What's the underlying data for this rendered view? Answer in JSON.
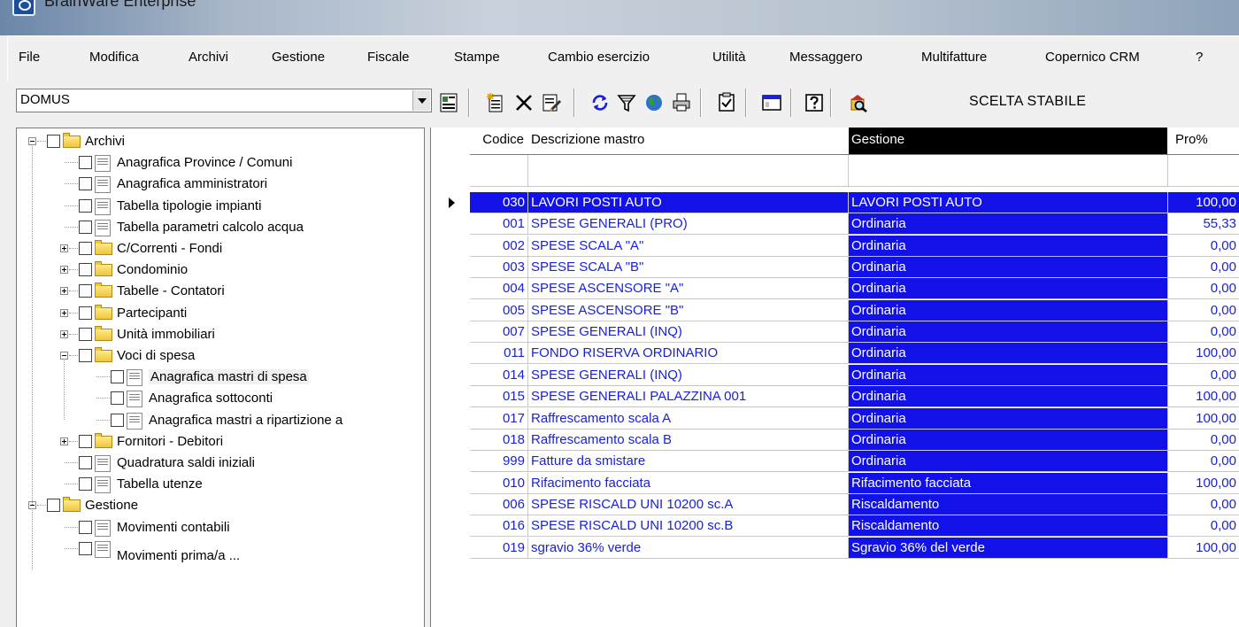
{
  "window": {
    "title": "BrainWare Enterprise"
  },
  "menu": [
    "File",
    "Modifica",
    "Archivi",
    "Gestione",
    "Fiscale",
    "Stampe",
    "Cambio esercizio",
    "Utilità",
    "Messaggero",
    "Multifatture",
    "Copernico CRM",
    "?"
  ],
  "toolbar": {
    "stabile_value": "DOMUS",
    "scelta_stabile": "SCELTA STABILE",
    "icons": [
      "stabile-icon",
      "new-icon",
      "delete-icon",
      "edit-icon",
      "refresh-icon",
      "filter-icon",
      "globe-icon",
      "print-icon",
      "check-icon",
      "window-icon",
      "help-icon",
      "search-building-icon"
    ]
  },
  "tree": [
    {
      "label": "Archivi",
      "level": 0,
      "expander": "minus",
      "icon": "folder"
    },
    {
      "label": "Anagrafica Province / Comuni",
      "level": 1,
      "expander": "",
      "icon": "doc"
    },
    {
      "label": "Anagrafica amministratori",
      "level": 1,
      "expander": "",
      "icon": "doc"
    },
    {
      "label": "Tabella tipologie impianti",
      "level": 1,
      "expander": "",
      "icon": "doc"
    },
    {
      "label": "Tabella parametri calcolo acqua",
      "level": 1,
      "expander": "",
      "icon": "doc"
    },
    {
      "label": "C/Correnti - Fondi",
      "level": 1,
      "expander": "plus",
      "icon": "folder"
    },
    {
      "label": "Condominio",
      "level": 1,
      "expander": "plus",
      "icon": "folder"
    },
    {
      "label": "Tabelle - Contatori",
      "level": 1,
      "expander": "plus",
      "icon": "folder"
    },
    {
      "label": "Partecipanti",
      "level": 1,
      "expander": "plus",
      "icon": "folder"
    },
    {
      "label": "Unità immobiliari",
      "level": 1,
      "expander": "plus",
      "icon": "folder"
    },
    {
      "label": "Voci di spesa",
      "level": 1,
      "expander": "minus",
      "icon": "folder"
    },
    {
      "label": "Anagrafica mastri di spesa",
      "level": 2,
      "expander": "",
      "icon": "doc",
      "selected": true
    },
    {
      "label": "Anagrafica sottoconti",
      "level": 2,
      "expander": "",
      "icon": "doc"
    },
    {
      "label": "Anagrafica mastri a ripartizione a",
      "level": 2,
      "expander": "",
      "icon": "doc"
    },
    {
      "label": "Fornitori - Debitori",
      "level": 1,
      "expander": "plus",
      "icon": "folder"
    },
    {
      "label": "Quadratura saldi iniziali",
      "level": 1,
      "expander": "",
      "icon": "doc"
    },
    {
      "label": "Tabella utenze",
      "level": 1,
      "expander": "",
      "icon": "doc"
    },
    {
      "label": "Gestione",
      "level": 0,
      "expander": "minus",
      "icon": "folder"
    },
    {
      "label": "Movimenti contabili",
      "level": 1,
      "expander": "",
      "icon": "doc"
    },
    {
      "label": "Movimenti prima/a ...",
      "level": 1,
      "expander": "",
      "icon": "doc",
      "cut": true
    }
  ],
  "grid": {
    "headers": {
      "codice": "Codice",
      "descrizione": "Descrizione mastro",
      "gestione": "Gestione",
      "pro": "Pro%"
    },
    "rows": [
      {
        "codice": "030",
        "descrizione": "LAVORI POSTI AUTO",
        "gestione": "LAVORI POSTI AUTO",
        "pro": "100,00",
        "current": true
      },
      {
        "codice": "001",
        "descrizione": "SPESE GENERALI (PRO)",
        "gestione": "Ordinaria",
        "pro": "55,33"
      },
      {
        "codice": "002",
        "descrizione": "SPESE SCALA \"A\"",
        "gestione": "Ordinaria",
        "pro": "0,00"
      },
      {
        "codice": "003",
        "descrizione": "SPESE SCALA \"B\"",
        "gestione": "Ordinaria",
        "pro": "0,00"
      },
      {
        "codice": "004",
        "descrizione": "SPESE ASCENSORE \"A\"",
        "gestione": "Ordinaria",
        "pro": "0,00"
      },
      {
        "codice": "005",
        "descrizione": "SPESE ASCENSORE \"B\"",
        "gestione": "Ordinaria",
        "pro": "0,00"
      },
      {
        "codice": "007",
        "descrizione": "SPESE GENERALI (INQ)",
        "gestione": "Ordinaria",
        "pro": "0,00"
      },
      {
        "codice": "011",
        "descrizione": "FONDO RISERVA ORDINARIO",
        "gestione": "Ordinaria",
        "pro": "100,00"
      },
      {
        "codice": "014",
        "descrizione": "SPESE GENERALI (INQ)",
        "gestione": "Ordinaria",
        "pro": "0,00"
      },
      {
        "codice": "015",
        "descrizione": "SPESE GENERALI PALAZZINA 001",
        "gestione": "Ordinaria",
        "pro": "100,00"
      },
      {
        "codice": "017",
        "descrizione": "Raffrescamento scala A",
        "gestione": "Ordinaria",
        "pro": "100,00"
      },
      {
        "codice": "018",
        "descrizione": "Raffrescamento scala B",
        "gestione": "Ordinaria",
        "pro": "0,00"
      },
      {
        "codice": "999",
        "descrizione": "Fatture da smistare",
        "gestione": "Ordinaria",
        "pro": "0,00"
      },
      {
        "codice": "010",
        "descrizione": "Rifacimento facciata",
        "gestione": "Rifacimento facciata",
        "pro": "100,00"
      },
      {
        "codice": "006",
        "descrizione": "SPESE RISCALD UNI 10200 sc.A",
        "gestione": "Riscaldamento",
        "pro": "0,00"
      },
      {
        "codice": "016",
        "descrizione": "SPESE RISCALD UNI 10200 sc.B",
        "gestione": "Riscaldamento",
        "pro": "0,00"
      },
      {
        "codice": "019",
        "descrizione": "sgravio 36% verde",
        "gestione": "Sgravio 36% del verde",
        "pro": "100,00"
      }
    ]
  },
  "colors": {
    "selection_blue": "#1212e8",
    "text_blue": "#1a22d8",
    "header_dark": "#000000"
  }
}
